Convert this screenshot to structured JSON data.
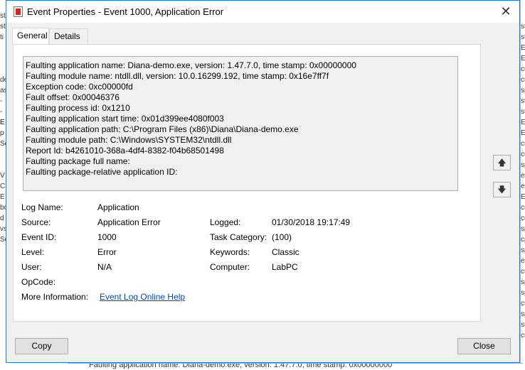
{
  "window": {
    "title": "Event Properties - Event 1000, Application Error",
    "close_glyph": "✕"
  },
  "tabs": [
    {
      "label": "General",
      "active": true
    },
    {
      "label": "Details",
      "active": false
    }
  ],
  "description_lines": [
    "Faulting application name: Diana-demo.exe, version: 1.47.7.0, time stamp: 0x00000000",
    "Faulting module name: ntdll.dll, version: 10.0.16299.192, time stamp: 0x16e7ff7f",
    "Exception code: 0xc00000fd",
    "Fault offset: 0x00046376",
    "Faulting process id: 0x1210",
    "Faulting application start time: 0x01d399ee4080f003",
    "Faulting application path: C:\\Program Files (x86)\\Diana\\Diana-demo.exe",
    "Faulting module path: C:\\Windows\\SYSTEM32\\ntdll.dll",
    "Report Id: b4261010-368a-4df4-8382-f04b68501498",
    "Faulting package full name:",
    "Faulting package-relative application ID:"
  ],
  "fields": {
    "log_name": {
      "label": "Log Name:",
      "value": "Application"
    },
    "source": {
      "label": "Source:",
      "value": "Application Error"
    },
    "logged": {
      "label": "Logged:",
      "value": "01/30/2018 19:17:49"
    },
    "event_id": {
      "label": "Event ID:",
      "value": "1000"
    },
    "task_category": {
      "label": "Task Category:",
      "value": "(100)"
    },
    "level": {
      "label": "Level:",
      "value": "Error"
    },
    "keywords": {
      "label": "Keywords:",
      "value": "Classic"
    },
    "user": {
      "label": "User:",
      "value": "N/A"
    },
    "computer": {
      "label": "Computer:",
      "value": "LabPC"
    },
    "opcode": {
      "label": "OpCode:",
      "value": ""
    },
    "more_info": {
      "label": "More Information:",
      "link": "Event Log Online Help"
    }
  },
  "nav": {
    "up_glyph": "🡅",
    "down_glyph": "🡇",
    "up_icon": "arrow-up-icon",
    "down_icon": "arrow-down-icon"
  },
  "buttons": {
    "copy": "Copy",
    "close": "Close"
  },
  "background": {
    "left_fragments": [
      "",
      "st",
      "st",
      "ti",
      "",
      "",
      "",
      "de",
      "as",
      "-",
      "- E",
      "E",
      "p",
      "Sc",
      "",
      "",
      "V",
      "C",
      "E",
      "bc",
      "d",
      "vs",
      "Sc"
    ],
    "right_fragments": [
      "",
      "",
      "st",
      "st",
      "EN",
      "EN",
      "cu",
      "cu",
      "sp",
      "st",
      "st",
      "EN",
      "EN",
      "cu",
      "cu",
      "sp",
      "ea",
      "ea",
      "EN",
      "cu",
      "cu",
      "sp",
      "cp",
      "sp",
      "ea",
      "cu",
      "sp",
      "sp",
      "cu",
      "sp",
      "st",
      "cu"
    ],
    "bottom_text": "Faulting application name: Diana-demo.exe, version: 1.47.7.0, time stamp: 0x00000000"
  },
  "colors": {
    "window_border": "#1a7fd4",
    "link": "#0645ad",
    "error_icon": "#d9261c"
  }
}
